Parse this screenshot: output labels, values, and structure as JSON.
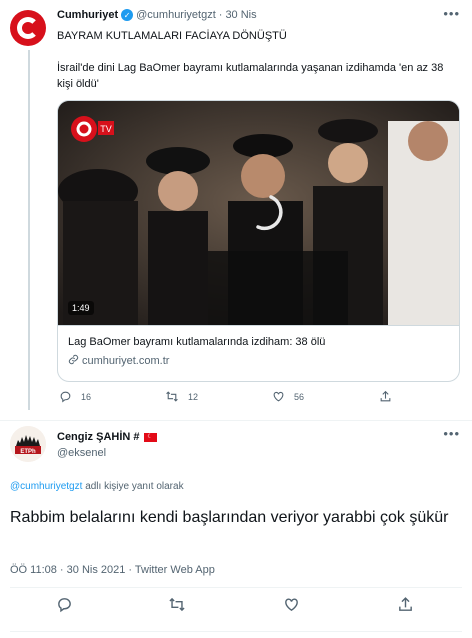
{
  "parent_tweet": {
    "author_name": "Cumhuriyet",
    "author_handle": "@cumhuriyetgzt",
    "separator": "·",
    "date": "30 Nis",
    "headline": "BAYRAM KUTLAMALARI FACİAYA DÖNÜŞTÜ",
    "body": "İsrail'de dini Lag BaOmer bayramı kutlamalarında yaşanan izdihamda 'en az 38 kişi öldü'",
    "card": {
      "video_duration": "1:49",
      "title": "Lag BaOmer bayramı kutlamalarında izdiham: 38 ölü",
      "domain": "cumhuriyet.com.tr"
    },
    "counts": {
      "replies": "16",
      "retweets": "12",
      "likes": "56"
    }
  },
  "reply_tweet": {
    "author_name": "Cengiz ŞAHİN #",
    "author_handle": "@eksenel",
    "replying_to_handle": "@cumhuriyetgzt",
    "replying_to_suffix": "adlı kişiye yanıt olarak",
    "text": "Rabbim belalarını kendi başlarından veriyor yarabbi çok şükür",
    "meta": "ÖÖ 11:08 · 30 Nis 2021 · Twitter Web App"
  },
  "colors": {
    "accent": "#1d9bf0",
    "muted": "#536471",
    "brand_red": "#d7101b",
    "border": "#cfd9de"
  }
}
